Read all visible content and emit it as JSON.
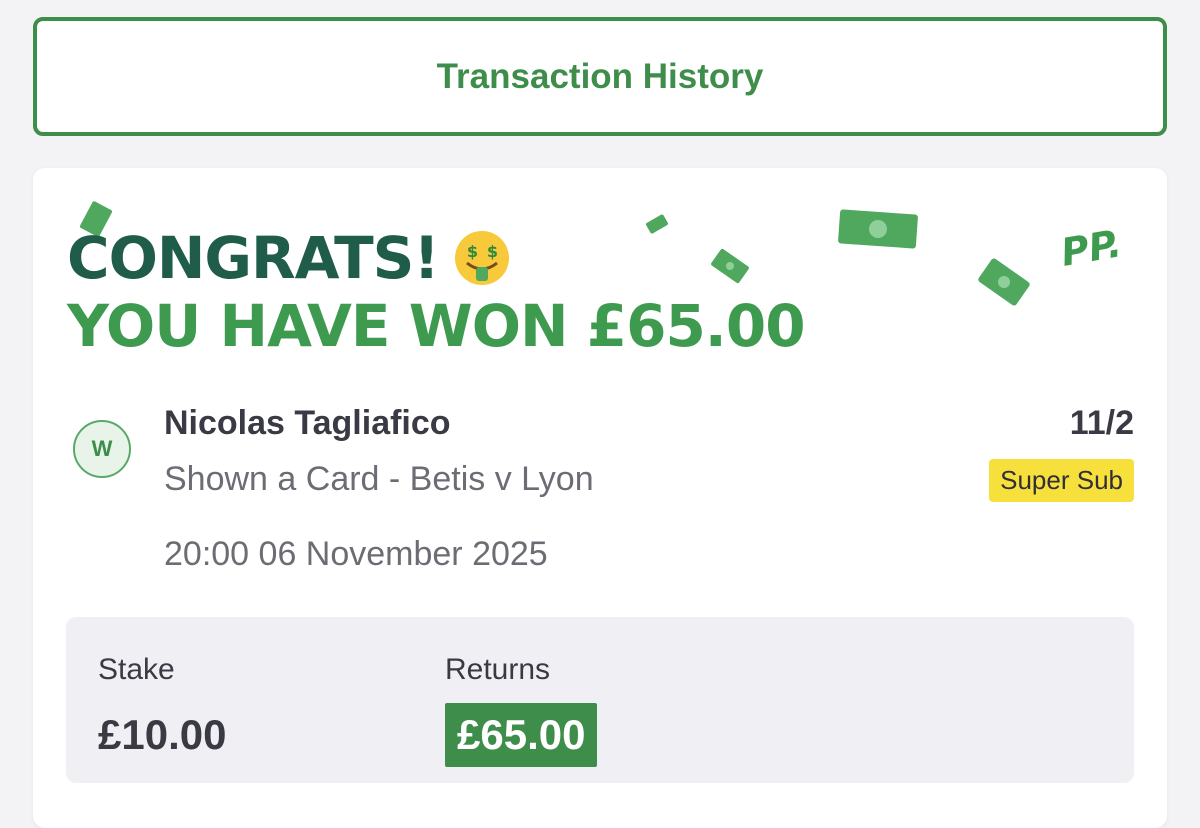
{
  "header": {
    "history_button_label": "Transaction History"
  },
  "card": {
    "headline_congrats": "CONGRATS!",
    "headline_won": "YOU HAVE WON £65.00",
    "brand_logo": "PP.",
    "result_badge": "W",
    "selection_name": "Nicolas Tagliafico",
    "market_event": "Shown a Card - Betis v Lyon",
    "odds": "11/2",
    "promo_badge": "Super Sub",
    "event_datetime": "20:00 06 November 2025",
    "stake_label": "Stake",
    "stake_value": "£10.00",
    "returns_label": "Returns",
    "returns_value": "£65.00"
  },
  "colors": {
    "brand_green": "#3e8d4b",
    "headline_dark": "#1f5c4a",
    "headline_green": "#3e9a4f",
    "promo_yellow": "#f7e03c"
  },
  "icons": [
    "money-mouth-face-icon",
    "banknote-confetti-icon"
  ]
}
